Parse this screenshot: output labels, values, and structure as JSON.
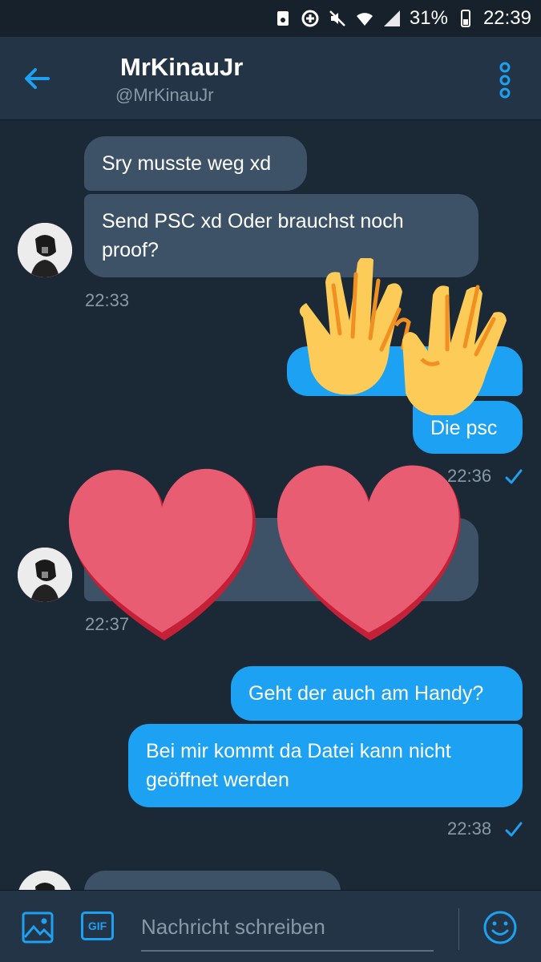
{
  "status_bar": {
    "battery": "31%",
    "time": "22:39"
  },
  "header": {
    "title": "MrKinauJr",
    "handle": "@MrKinauJr"
  },
  "messages": {
    "m1": "Sry musste weg xd",
    "m2": "Send PSC xd Oder brauchst noch proof?",
    "t1": "22:33",
    "m3": "Die psc",
    "t2": "22:36",
    "t3": "22:37",
    "m4": "Geht der auch am Handy?",
    "m5": "Bei mir kommt da Datei kann nicht geöffnet werden",
    "t4": "22:38"
  },
  "composer": {
    "placeholder": "Nachricht schreiben",
    "gif_label": "GIF"
  },
  "colors": {
    "accent": "#1da1f2",
    "background": "#1b2836",
    "header": "#243447",
    "incoming": "#3d5266"
  }
}
